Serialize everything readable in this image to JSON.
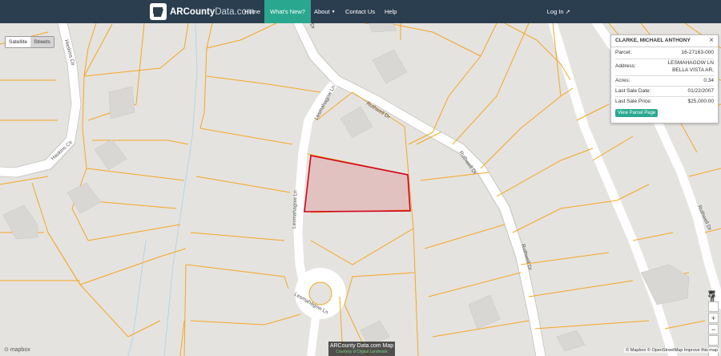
{
  "nav": {
    "brand_prefix": "ARCounty",
    "brand_suffix": "Data.com",
    "items": [
      {
        "label": "Home",
        "active": false
      },
      {
        "label": "What's New?",
        "active": true
      },
      {
        "label": "About",
        "active": false,
        "dropdown": true
      },
      {
        "label": "Contact Us",
        "active": false
      },
      {
        "label": "Help",
        "active": false
      }
    ],
    "login": "Log In"
  },
  "map": {
    "layers": {
      "satellite": "Satellite",
      "streets": "Streets",
      "selected": "Satellite"
    },
    "roads": {
      "rutwell_1": "Ruthwell Dr",
      "rutwell_2": "Ruthwell Dr",
      "rutwell_3": "Ruthwell Dr",
      "rutwell_4": "Ruthwell Dr",
      "lesmahagow_1": "Lesmahagow Ln",
      "lesmahagow_2": "Lesmahagow Ln",
      "lesmahagow_3": "Lesmahagow Ln",
      "haskins_1": "Haskins Cir",
      "haskins_2": "Haskins Cir",
      "top_dr": "Dr"
    },
    "mapbox": "mapbox",
    "attribution": "© Mapbox © OpenStreetMap Improve this map",
    "caption": "ARCounty Data.com Map",
    "caption_sub": "Courtesy of Digital Landmark"
  },
  "popup": {
    "title": "CLARKE, MICHAEL ANTHONY",
    "close": "×",
    "fields": [
      {
        "label": "Parcel:",
        "value": "16-27163-000"
      },
      {
        "label": "Address:",
        "value": "LESMAHAGOW LN",
        "value2": "BELLA VISTA AR,"
      },
      {
        "label": "Acres:",
        "value": "0.34"
      },
      {
        "label": "Last Sale Date:",
        "value": "01/22/2007"
      },
      {
        "label": "Last Sale Price:",
        "value": "$25,000.00"
      }
    ],
    "button": "View Parcel Page"
  },
  "colors": {
    "navbar": "#2b3e50",
    "accent": "#2aa88f",
    "parcel_line": "#f5a623",
    "road": "#ffffff",
    "selected_parcel": "#d0021b"
  },
  "icons": {
    "pegman": "pegman-icon",
    "locate": "locate-icon",
    "zoom_in": "zoom-in-icon",
    "zoom_out": "zoom-out-icon",
    "compass": "compass-icon",
    "fullscreen": "fullscreen-icon"
  }
}
